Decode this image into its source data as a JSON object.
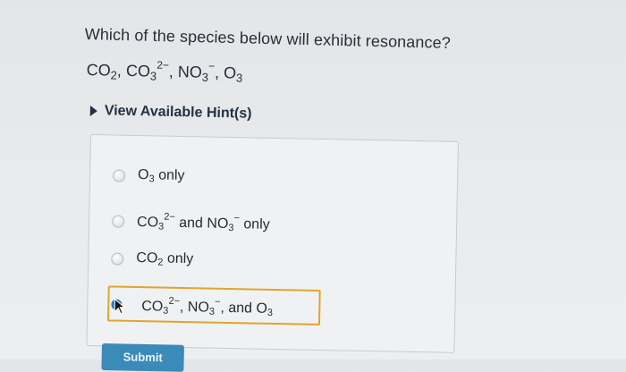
{
  "question": {
    "text": "Which of the species below will exhibit resonance?",
    "species_line": [
      {
        "base": "CO",
        "sub": "2",
        "sup": "",
        "trail": ", "
      },
      {
        "base": "CO",
        "sub": "3",
        "sup": "2−",
        "trail": ", "
      },
      {
        "base": "NO",
        "sub": "3",
        "sup": "−",
        "trail": ", "
      },
      {
        "base": "O",
        "sub": "3",
        "sup": "",
        "trail": ""
      }
    ]
  },
  "hint": {
    "label": "View Available Hint(s)"
  },
  "options": [
    {
      "text_parts": [
        {
          "t": "O"
        },
        {
          "sub": "3"
        },
        {
          "t": " only"
        }
      ]
    },
    {
      "text_parts": [
        {
          "t": "CO"
        },
        {
          "sub": "3"
        },
        {
          "sup": "2−"
        },
        {
          "t": " and NO"
        },
        {
          "sub": "3"
        },
        {
          "sup": "−"
        },
        {
          "t": " only"
        }
      ]
    },
    {
      "text_parts": [
        {
          "t": "CO"
        },
        {
          "sub": "2"
        },
        {
          "t": " only"
        }
      ]
    },
    {
      "text_parts": [
        {
          "t": "CO"
        },
        {
          "sub": "3"
        },
        {
          "sup": "2−"
        },
        {
          "t": ", NO"
        },
        {
          "sub": "3"
        },
        {
          "sup": "−"
        },
        {
          "t": ", and O"
        },
        {
          "sub": "3"
        }
      ]
    }
  ],
  "selected_option_index": 3,
  "submit": {
    "label": "Submit"
  },
  "colors": {
    "selection_border": "#e0a52b",
    "submit_bg": "#3a8bb8"
  }
}
